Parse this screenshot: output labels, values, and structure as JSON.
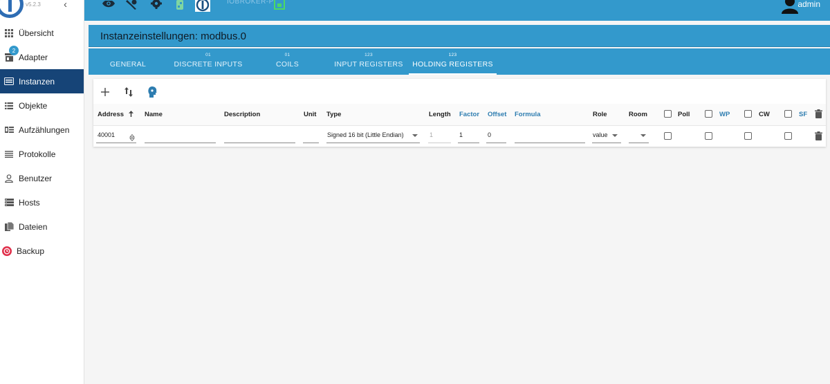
{
  "app": {
    "version": "v5.2.3",
    "host_label": "IOBROKER-PI",
    "user": "admin"
  },
  "sidebar": {
    "items": [
      {
        "label": "Übersicht",
        "icon": "grid-icon"
      },
      {
        "label": "Adapter",
        "icon": "store-icon",
        "badge": "2"
      },
      {
        "label": "Instanzen",
        "icon": "instances-icon",
        "active": true
      },
      {
        "label": "Objekte",
        "icon": "list-icon"
      },
      {
        "label": "Aufzählungen",
        "icon": "enum-icon"
      },
      {
        "label": "Protokolle",
        "icon": "log-icon"
      },
      {
        "label": "Benutzer",
        "icon": "user-icon"
      },
      {
        "label": "Hosts",
        "icon": "hosts-icon"
      },
      {
        "label": "Dateien",
        "icon": "files-icon"
      },
      {
        "label": "Backup",
        "icon": "backup-icon"
      }
    ]
  },
  "page": {
    "title": "Instanzeinstellungen: modbus.0"
  },
  "tabs": [
    {
      "sub": "",
      "label": "GENERAL"
    },
    {
      "sub": "01",
      "label": "DISCRETE INPUTS"
    },
    {
      "sub": "01",
      "label": "COILS"
    },
    {
      "sub": "123",
      "label": "INPUT REGISTERS"
    },
    {
      "sub": "123",
      "label": "HOLDING REGISTERS"
    }
  ],
  "table": {
    "headers": {
      "address": "Address",
      "name": "Name",
      "description": "Description",
      "unit": "Unit",
      "type": "Type",
      "length": "Length",
      "factor": "Factor",
      "offset": "Offset",
      "formula": "Formula",
      "role": "Role",
      "room": "Room",
      "poll": "Poll",
      "wp": "WP",
      "cw": "CW",
      "sf": "SF"
    },
    "row": {
      "address": "40001",
      "name": "",
      "description": "",
      "unit": "",
      "type": "Signed 16 bit (Little Endian)",
      "length": "1",
      "factor": "1",
      "offset": "0",
      "formula": "",
      "role": "value",
      "room": ""
    }
  },
  "colors": {
    "accent": "#3399cc",
    "active_nav": "#164477",
    "link_header": "#2e7db0"
  }
}
